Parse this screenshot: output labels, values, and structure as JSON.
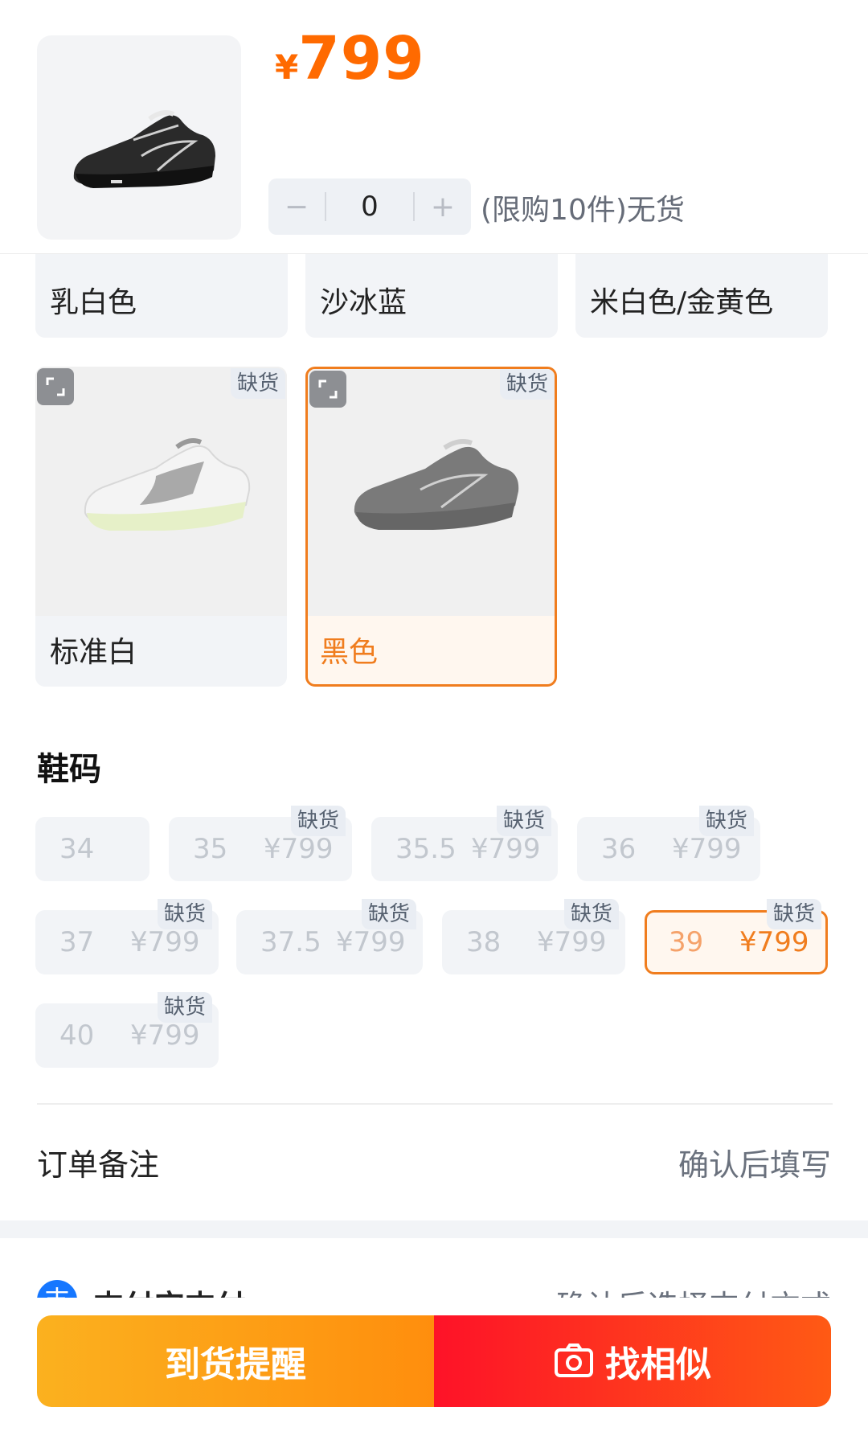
{
  "product": {
    "currency": "¥",
    "price": "799",
    "quantity": "0",
    "minus": "−",
    "plus": "+",
    "stock_note": "(限购10件)无货"
  },
  "colors": {
    "top_row": [
      "乳白色",
      "沙冰蓝",
      "米白色/金黄色"
    ],
    "image_options": [
      {
        "label": "标准白",
        "badge": "缺货",
        "selected": false
      },
      {
        "label": "黑色",
        "badge": "缺货",
        "selected": true
      }
    ]
  },
  "sizes": {
    "title": "鞋码",
    "items": [
      {
        "size": "34",
        "price": "",
        "badge": ""
      },
      {
        "size": "35",
        "price": "¥799",
        "badge": "缺货"
      },
      {
        "size": "35.5",
        "price": "¥799",
        "badge": "缺货"
      },
      {
        "size": "36",
        "price": "¥799",
        "badge": "缺货"
      },
      {
        "size": "37",
        "price": "¥799",
        "badge": "缺货"
      },
      {
        "size": "37.5",
        "price": "¥799",
        "badge": "缺货"
      },
      {
        "size": "38",
        "price": "¥799",
        "badge": "缺货"
      },
      {
        "size": "39",
        "price": "¥799",
        "badge": "缺货",
        "selected": true
      },
      {
        "size": "40",
        "price": "¥799",
        "badge": "缺货"
      }
    ]
  },
  "remark": {
    "label": "订单备注",
    "value": "确认后填写"
  },
  "payment": {
    "icon_char": "支",
    "label": "支付宝支付",
    "value": "确认后选择支付方式"
  },
  "actions": {
    "notify_label": "到货提醒",
    "similar_label": "找相似"
  },
  "theme": {
    "accent": "#ff6a00",
    "selected_border": "#f07d1e"
  }
}
